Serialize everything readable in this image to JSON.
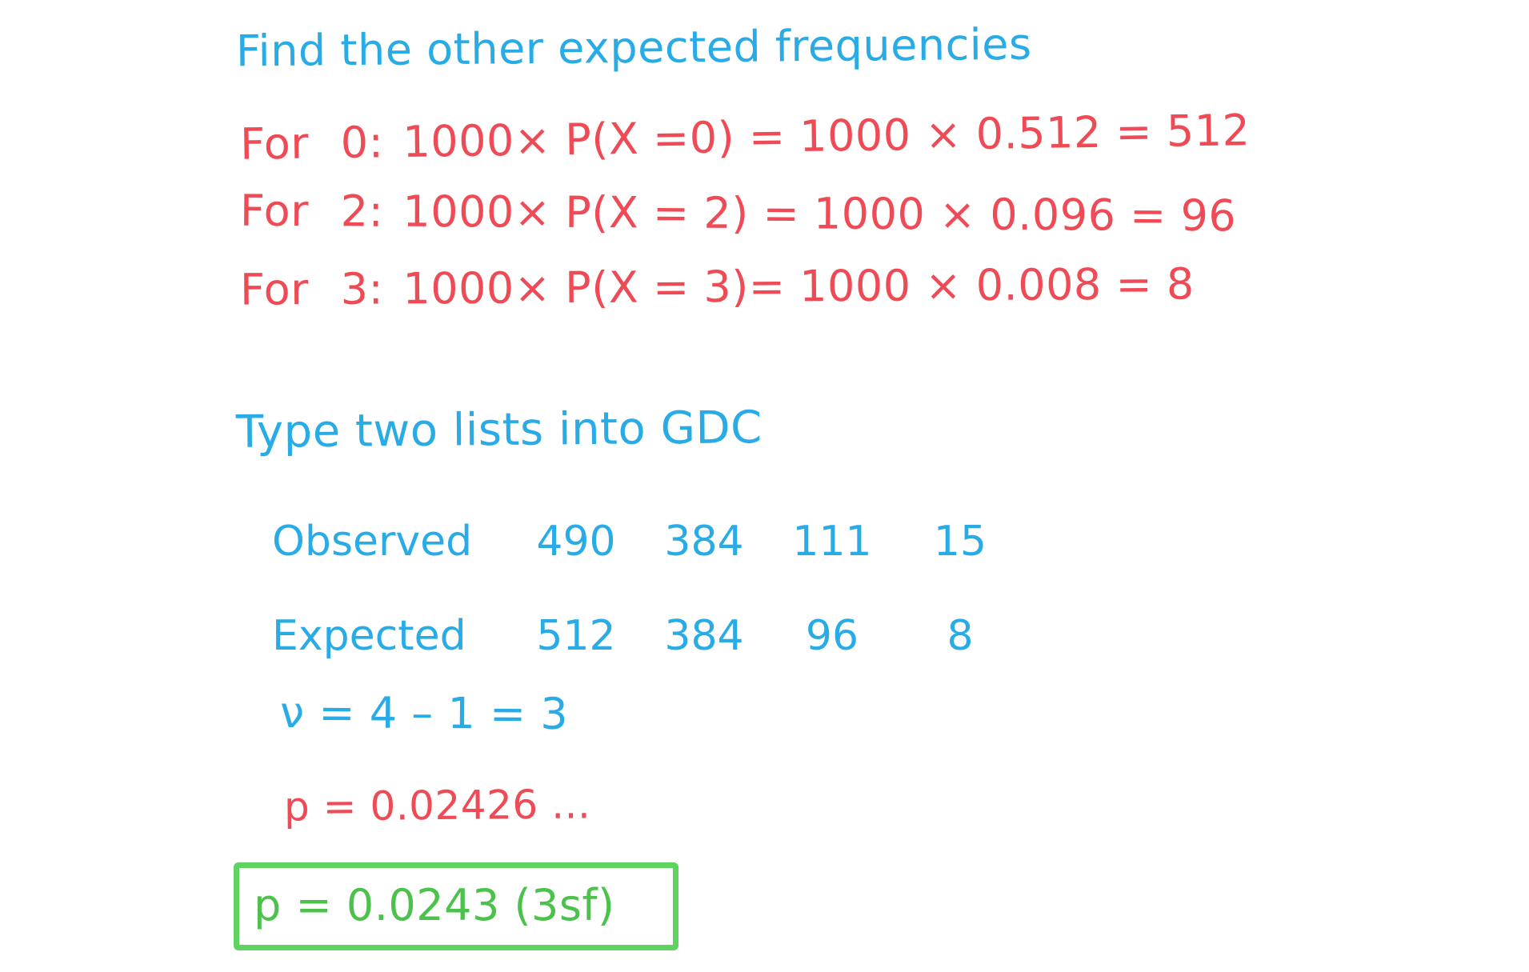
{
  "page": {
    "title": "Find the other expected frequencies",
    "colors": {
      "blue": "#29ABE6",
      "red": "#EE4B56",
      "green": "#4CC24C",
      "box_border": "#5FD35F",
      "background": "#FFFFFF"
    }
  },
  "working": {
    "lines": [
      {
        "label": "For",
        "outcome": "0:",
        "expression": "1000× P(X =0) = 1000 × 0.512 = 512",
        "n": 1000,
        "probability": 0.512,
        "expected": 512
      },
      {
        "label": "For",
        "outcome": "2:",
        "expression": "1000× P(X = 2) = 1000 × 0.096 = 96",
        "n": 1000,
        "probability": 0.096,
        "expected": 96
      },
      {
        "label": "For",
        "outcome": "3:",
        "expression": "1000× P(X = 3)= 1000 × 0.008 = 8",
        "n": 1000,
        "probability": 0.008,
        "expected": 8
      }
    ]
  },
  "gdc": {
    "instruction": "Type two lists into GDC",
    "table": {
      "rows": [
        {
          "label": "Observed",
          "values": [
            "490",
            "384",
            "111",
            "15"
          ]
        },
        {
          "label": "Expected",
          "values": [
            "512",
            "384",
            "96",
            "8"
          ]
        }
      ]
    }
  },
  "statistics": {
    "degrees_of_freedom": "ν = 4 – 1 = 3",
    "p_value_full": "p = 0.02426 ...",
    "p_value_rounded": "p = 0.0243 (3sf)"
  }
}
